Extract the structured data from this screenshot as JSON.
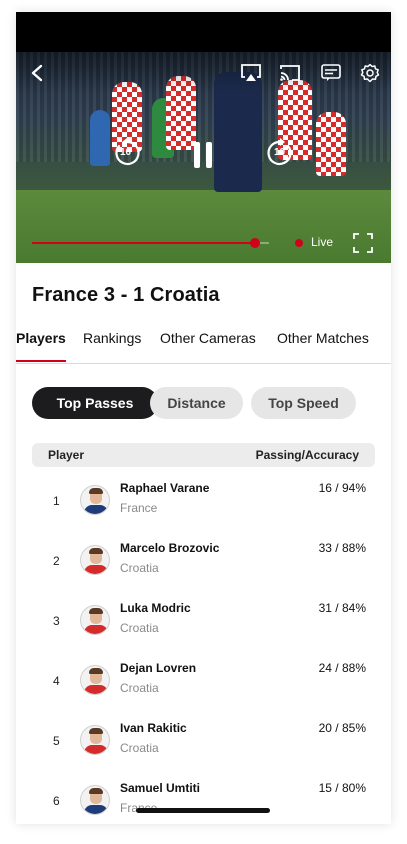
{
  "video": {
    "skip_back_label": "10",
    "skip_forward_label": "10",
    "progress_fraction": 0.94,
    "live_label": "Live",
    "accent_color": "#d0021b",
    "icons": [
      "back-icon",
      "airplay-icon",
      "cast-icon",
      "captions-icon",
      "settings-icon",
      "rewind-10-icon",
      "pause-icon",
      "forward-10-icon",
      "fullscreen-icon"
    ]
  },
  "match": {
    "title": "France 3 - 1 Croatia"
  },
  "tabs": [
    {
      "label": "Players",
      "active": true
    },
    {
      "label": "Rankings",
      "active": false
    },
    {
      "label": "Other Cameras",
      "active": false
    },
    {
      "label": "Other Matches",
      "active": false
    }
  ],
  "filters": [
    {
      "label": "Top Passes",
      "active": true
    },
    {
      "label": "Distance",
      "active": false
    },
    {
      "label": "Top Speed",
      "active": false
    }
  ],
  "table": {
    "headers": {
      "player": "Player",
      "stat": "Passing/Accuracy"
    },
    "rows": [
      {
        "rank": "1",
        "name": "Raphael Varane",
        "country": "France",
        "stat": "16 / 94%"
      },
      {
        "rank": "2",
        "name": "Marcelo Brozovic",
        "country": "Croatia",
        "stat": "33 / 88%"
      },
      {
        "rank": "3",
        "name": "Luka Modric",
        "country": "Croatia",
        "stat": "31 / 84%"
      },
      {
        "rank": "4",
        "name": "Dejan Lovren",
        "country": "Croatia",
        "stat": "24 / 88%"
      },
      {
        "rank": "5",
        "name": "Ivan Rakitic",
        "country": "Croatia",
        "stat": "20 / 85%"
      },
      {
        "rank": "6",
        "name": "Samuel Umtiti",
        "country": "France",
        "stat": "15 / 80%"
      }
    ]
  },
  "colors": {
    "france_shirt": "#1f3c7a",
    "croatia_shirt": "#d62b2b"
  }
}
